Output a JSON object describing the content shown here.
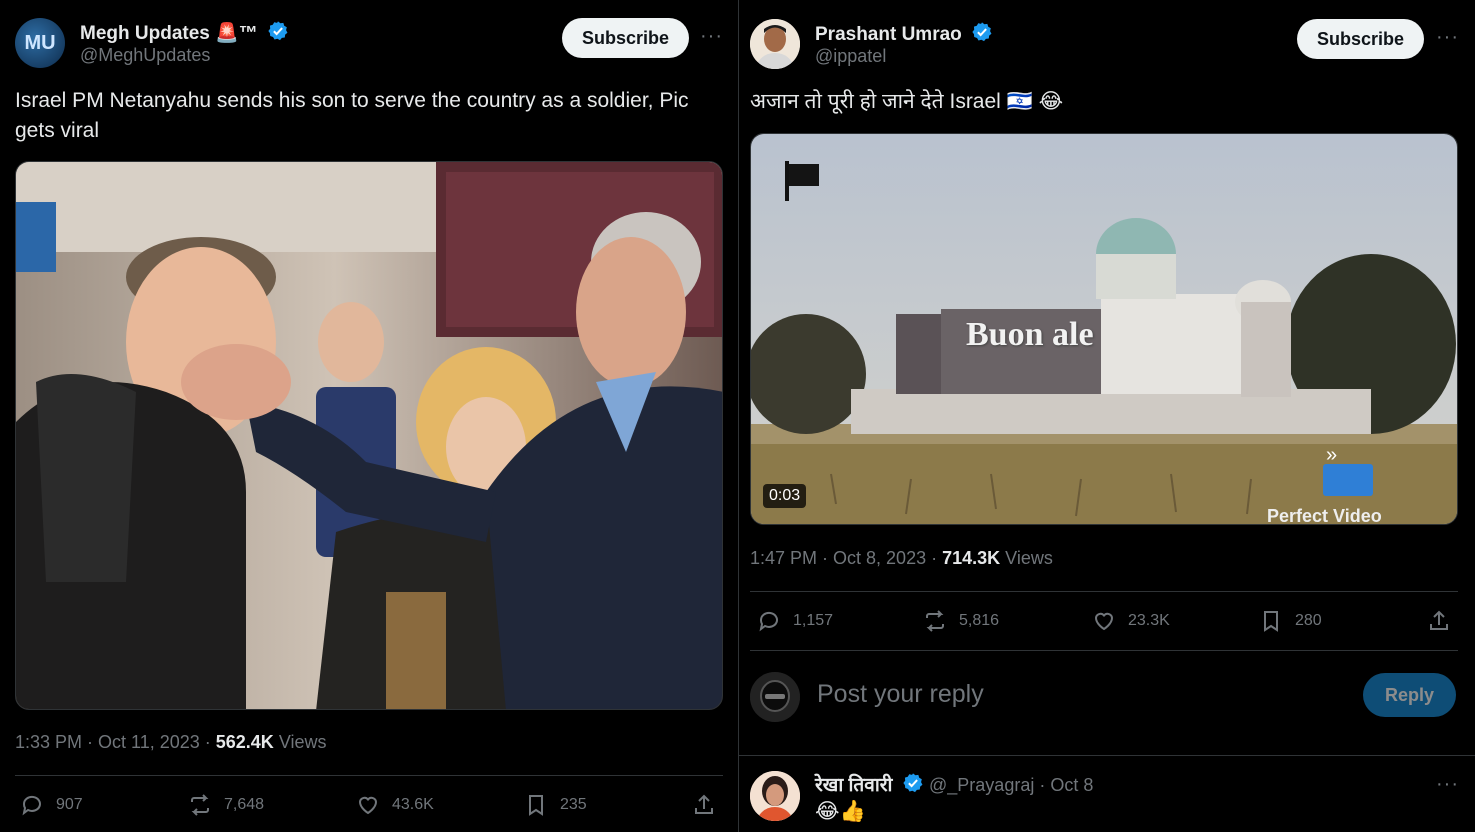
{
  "left_tweet": {
    "author": {
      "name": "Megh Updates 🚨™",
      "handle": "@MeghUpdates",
      "avatar_text": "MU"
    },
    "subscribe_label": "Subscribe",
    "more_label": "···",
    "text": "Israel PM Netanyahu sends his son to serve the country as a soldier, Pic gets viral",
    "timestamp": "1:33 PM · Oct 11, 2023 · ",
    "views_count": "562.4K",
    "views_label": " Views",
    "stats": {
      "replies": "907",
      "reposts": "7,648",
      "likes": "43.6K",
      "bookmarks": "235"
    }
  },
  "right_tweet": {
    "author": {
      "name": "Prashant Umrao",
      "handle": "@ippatel"
    },
    "subscribe_label": "Subscribe",
    "more_label": "···",
    "text": "अजान तो पूरी हो जाने देते Israel 🇮🇱 😂",
    "video": {
      "duration": "0:03",
      "overlay_text": "Buon  ale",
      "watermark": "Perfect Video"
    },
    "timestamp": "1:47 PM · Oct 8, 2023 · ",
    "views_count": "714.3K",
    "views_label": " Views",
    "stats": {
      "replies": "1,157",
      "reposts": "5,816",
      "likes": "23.3K",
      "bookmarks": "280"
    },
    "reply_box": {
      "placeholder": "Post your reply",
      "button_label": "Reply"
    },
    "reply": {
      "name": "रेखा तिवारी",
      "handle_time": "@_Prayagraj · Oct 8",
      "text": "😂👍",
      "more_label": "···"
    }
  },
  "colors": {
    "background": "#000000",
    "text_primary": "#e7e9ea",
    "text_secondary": "#71767b",
    "verified_blue": "#1d9bf0",
    "reply_button": "#1a8cd8",
    "subscribe_bg": "#eff3f4"
  },
  "icons": [
    "verified-icon",
    "reply-icon",
    "repost-icon",
    "like-icon",
    "bookmark-icon",
    "share-icon",
    "more-icon"
  ]
}
